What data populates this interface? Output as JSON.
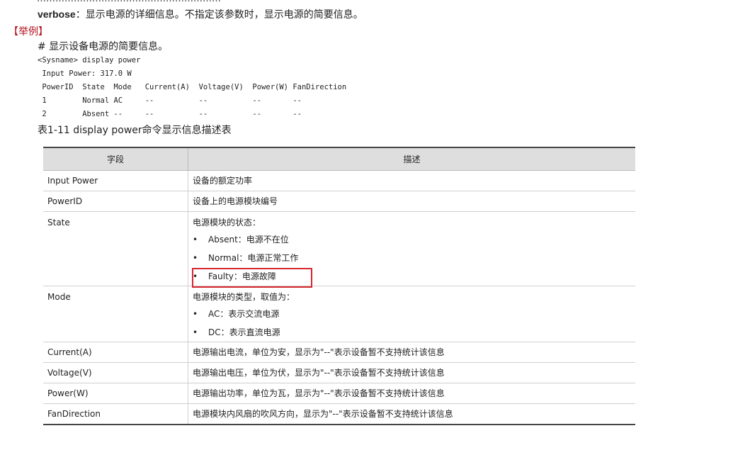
{
  "top_cut_text": "……………………………………………………",
  "verbose": {
    "keyword": "verbose",
    "text": "：显示电源的详细信息。不指定该参数时，显示电源的简要信息。"
  },
  "example_heading": "【举例】",
  "comment": "# 显示设备电源的简要信息。",
  "code_lines": [
    "<Sysname> display power",
    " Input Power: 317.0 W",
    " PowerID  State  Mode   Current(A)  Voltage(V)  Power(W) FanDirection",
    " 1        Normal AC     --          --          --       --",
    " 2        Absent --     --          --          --       --"
  ],
  "table_caption": "表1-11 display power命令显示信息描述表",
  "table": {
    "headers": [
      "字段",
      "描述"
    ],
    "rows": [
      {
        "field": "Input Power",
        "desc": "设备的额定功率"
      },
      {
        "field": "PowerID",
        "desc": "设备上的电源模块编号"
      },
      {
        "field": "State",
        "intro": "电源模块的状态：",
        "bullets": [
          "Absent：电源不在位",
          "Normal：电源正常工作",
          "Faulty：电源故障"
        ]
      },
      {
        "field": "Mode",
        "intro": "电源模块的类型，取值为：",
        "bullets": [
          "AC：表示交流电源",
          "DC：表示直流电源"
        ]
      },
      {
        "field": "Current(A)",
        "desc": "电源输出电流，单位为安，显示为\"--\"表示设备暂不支持统计该信息"
      },
      {
        "field": "Voltage(V)",
        "desc": "电源输出电压，单位为伏，显示为\"--\"表示设备暂不支持统计该信息"
      },
      {
        "field": "Power(W)",
        "desc": "电源输出功率，单位为瓦，显示为\"--\"表示设备暂不支持统计该信息"
      },
      {
        "field": "FanDirection",
        "desc": "电源模块内风扇的吹风方向，显示为\"--\"表示设备暂不支持统计该信息"
      }
    ]
  },
  "bullet_glyph": "•",
  "colors": {
    "heading_red": "#b3121c",
    "highlight_red": "#d7262e",
    "table_header_bg": "#dedede"
  }
}
